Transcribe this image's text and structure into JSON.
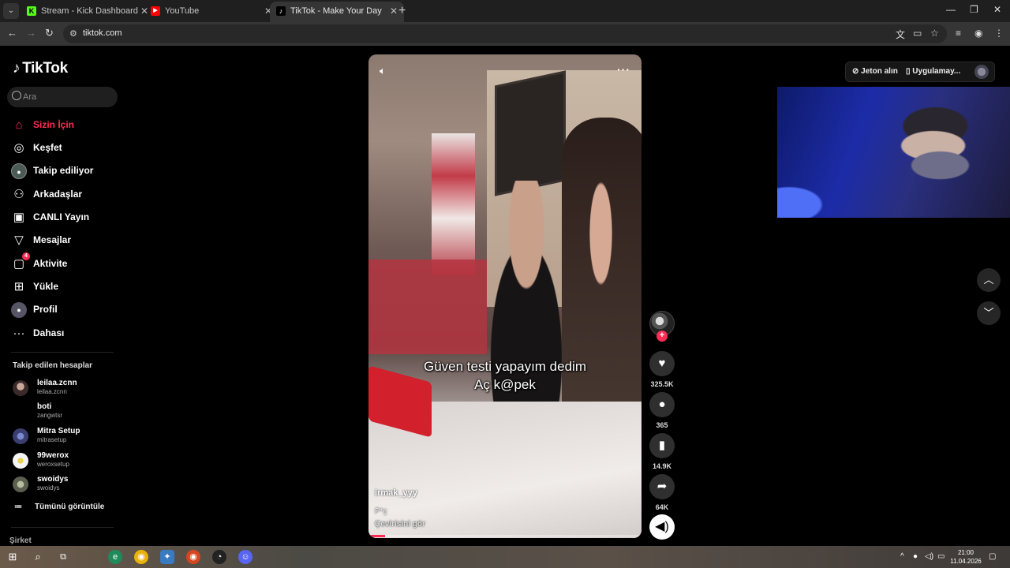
{
  "browser": {
    "tabs": [
      {
        "title": "Stream - Kick Dashboard",
        "icon": "kick-icon",
        "color": "#53fc18"
      },
      {
        "title": "YouTube",
        "icon": "youtube-icon",
        "color": "#ff0000"
      },
      {
        "title": "TikTok - Make Your Day",
        "icon": "tiktok-icon",
        "color": "#000000"
      }
    ],
    "url": "tiktok.com"
  },
  "sidebar": {
    "logo": "TikTok",
    "search_placeholder": "Ara",
    "nav": [
      {
        "label": "Sizin İçin",
        "icon": "home-icon",
        "active": true
      },
      {
        "label": "Keşfet",
        "icon": "compass-icon"
      },
      {
        "label": "Takip ediliyor",
        "icon": "following-avatar-icon"
      },
      {
        "label": "Arkadaşlar",
        "icon": "friends-icon"
      },
      {
        "label": "CANLI Yayın",
        "icon": "live-icon"
      },
      {
        "label": "Mesajlar",
        "icon": "messages-icon"
      },
      {
        "label": "Aktivite",
        "icon": "activity-icon",
        "badge": "4"
      },
      {
        "label": "Yükle",
        "icon": "upload-icon"
      },
      {
        "label": "Profil",
        "icon": "profile-icon"
      },
      {
        "label": "Dahası",
        "icon": "more-icon"
      }
    ],
    "following_title": "Takip edilen hesaplar",
    "accounts": [
      {
        "name": "leilaa.zcnn",
        "handle": "leilaa.zcnn"
      },
      {
        "name": "boti",
        "handle": "zangwtsr"
      },
      {
        "name": "Mitra Setup",
        "handle": "mitrasetup"
      },
      {
        "name": "99werox",
        "handle": "weroxsetup"
      },
      {
        "name": "swoidys",
        "handle": "swoidys"
      }
    ],
    "see_all": "Tümünü görüntüle",
    "company": "Şirket"
  },
  "video": {
    "caption_line1": "Güven testi yapayım dedim",
    "caption_line2": "Aç k@pek",
    "author": "irmak_yyy",
    "description": "P*ç",
    "translate": "Çevirisini gör",
    "progress": 0.06
  },
  "actions": {
    "likes": "325.5K",
    "comments": "365",
    "saves": "14.9K",
    "shares": "64K"
  },
  "header": {
    "coins": "Jeton alın",
    "get_app": "Uygulamay..."
  },
  "taskbar": {
    "time": "21:00",
    "date": "11.04.2026"
  }
}
